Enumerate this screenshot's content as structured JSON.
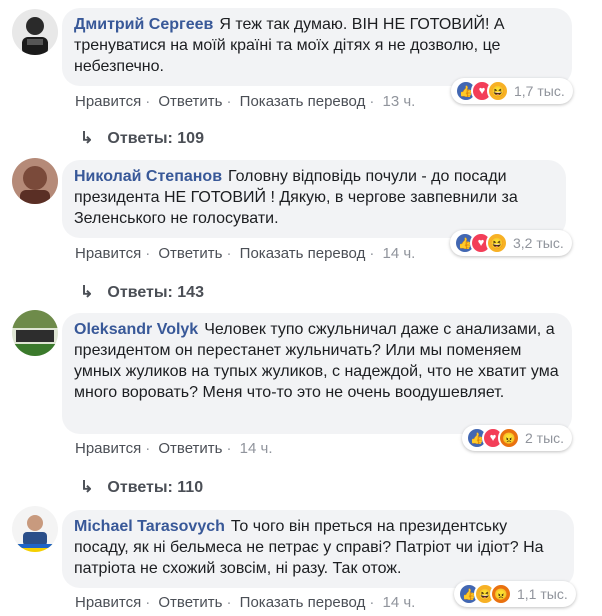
{
  "comments": [
    {
      "author": "Дмитрий Сергеев",
      "text": "Я теж так думаю. ВІН НЕ ГОТОВИЙ! А тренуватися на моїй країні та моїх дітях я не дозволю, це небезпечно.",
      "actions": [
        "Нравится",
        "Ответить",
        "Показать перевод",
        "13 ч."
      ],
      "reactions": [
        "like-icon",
        "love-icon",
        "haha-icon"
      ],
      "reaction_count": "1,7 тыс.",
      "replies": "Ответы: 109"
    },
    {
      "author": "Николай Степанов",
      "text": "Головну відповідь почули - до посади президента НЕ ГОТОВИЙ ! Дякую, в черговe завпевнили за Зеленського не голосувати.",
      "actions": [
        "Нравится",
        "Ответить",
        "Показать перевод",
        "14 ч."
      ],
      "reactions": [
        "like-icon",
        "love-icon",
        "haha-icon"
      ],
      "reaction_count": "3,2 тыс.",
      "replies": "Ответы: 143"
    },
    {
      "author": "Oleksandr Volyk",
      "text": "Человек тупо сжульничал даже с анализами, а президентом он перестанет жульничать? Или мы поменяем умных жуликов на тупых жуликов, с надеждой, что не хватит ума много воровать? Меня что-то это не очень воодушевляет.",
      "actions": [
        "Нравится",
        "Ответить",
        "14 ч."
      ],
      "reactions": [
        "like-icon",
        "love-icon",
        "angry-icon"
      ],
      "reaction_count": "2 тыс.",
      "replies": "Ответы: 110"
    },
    {
      "author": "Michael Tarasovych",
      "text": "То чого він преться на президентську посаду, як ні бельмеса не петрає у справі? Патріот чи ідіот? На патріота не схожий зовсім, ні разу. Так отож.",
      "actions": [
        "Нравится",
        "Ответить",
        "Показать перевод",
        "14 ч."
      ],
      "reactions": [
        "like-icon",
        "haha-icon",
        "angry-icon"
      ],
      "reaction_count": "1,1 тыс."
    }
  ],
  "colors": {
    "author": "#385898",
    "bubble": "#f2f3f5",
    "meta": "#90949c",
    "like": "#4267b2",
    "love": "#f33e58",
    "haha": "#f7b125",
    "angry": "#e9710f"
  }
}
